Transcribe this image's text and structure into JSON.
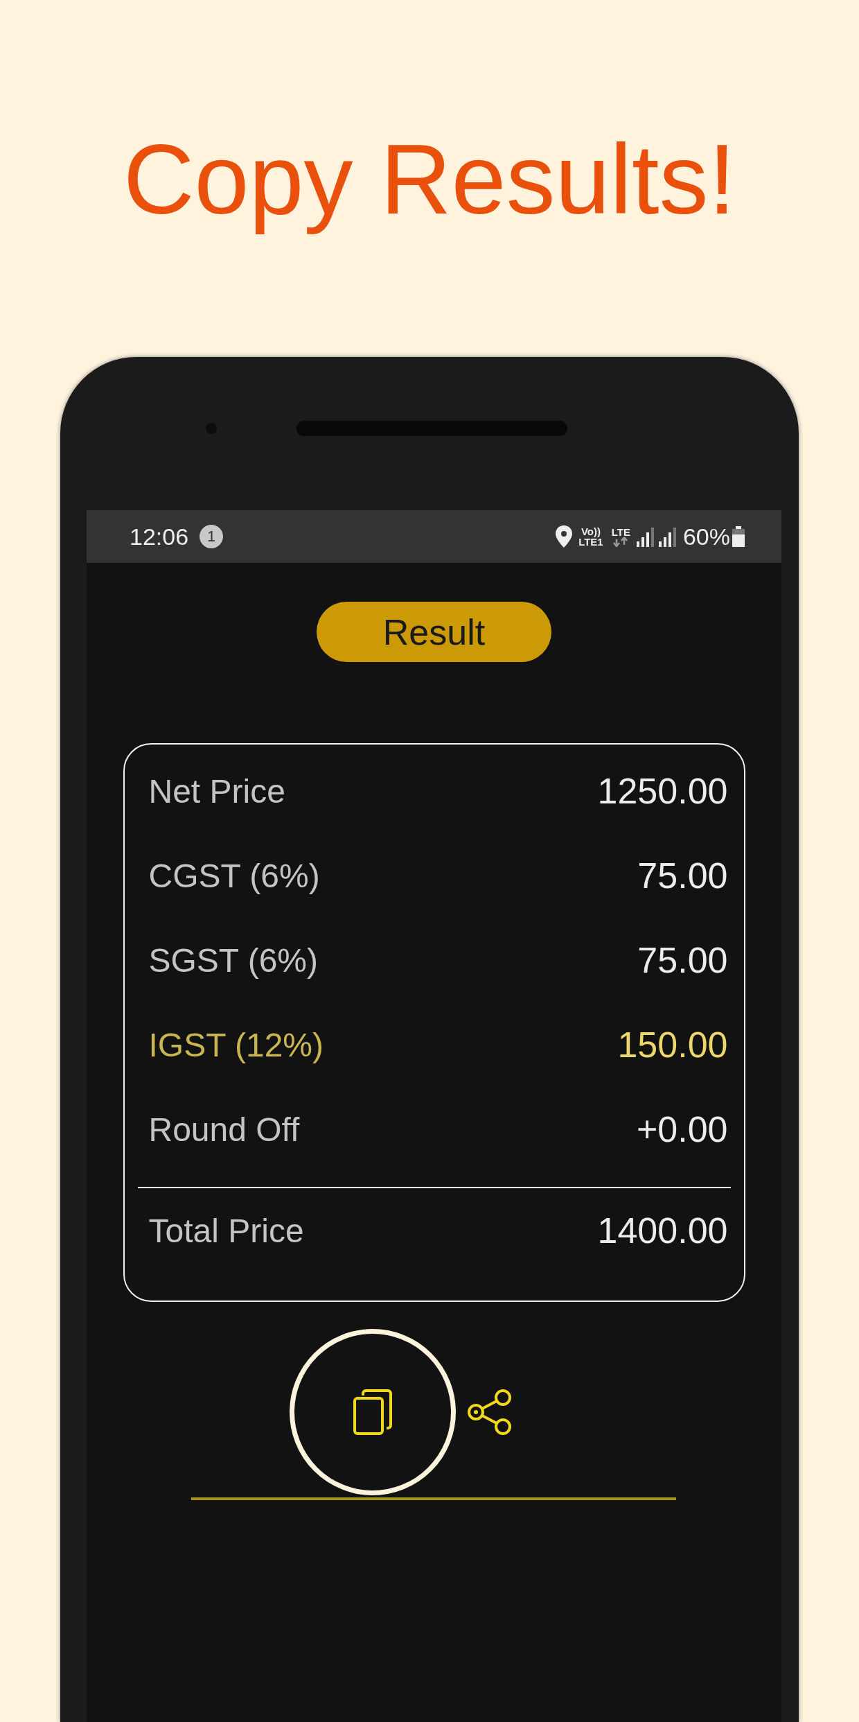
{
  "headline": "Copy Results!",
  "status_bar": {
    "time": "12:06",
    "notification_count": "1",
    "volte_top": "Vo))",
    "volte_bottom": "LTE1",
    "network": "LTE",
    "battery": "60%"
  },
  "title": "Result",
  "rows": [
    {
      "label": "Net Price",
      "value": "1250.00",
      "highlighted": false
    },
    {
      "label": "CGST (6%)",
      "value": "75.00",
      "highlighted": false
    },
    {
      "label": "SGST (6%)",
      "value": "75.00",
      "highlighted": false
    },
    {
      "label": "IGST (12%)",
      "value": "150.00",
      "highlighted": true
    },
    {
      "label": "Round Off",
      "value": "+0.00",
      "highlighted": false
    }
  ],
  "total": {
    "label": "Total Price",
    "value": "1400.00"
  }
}
